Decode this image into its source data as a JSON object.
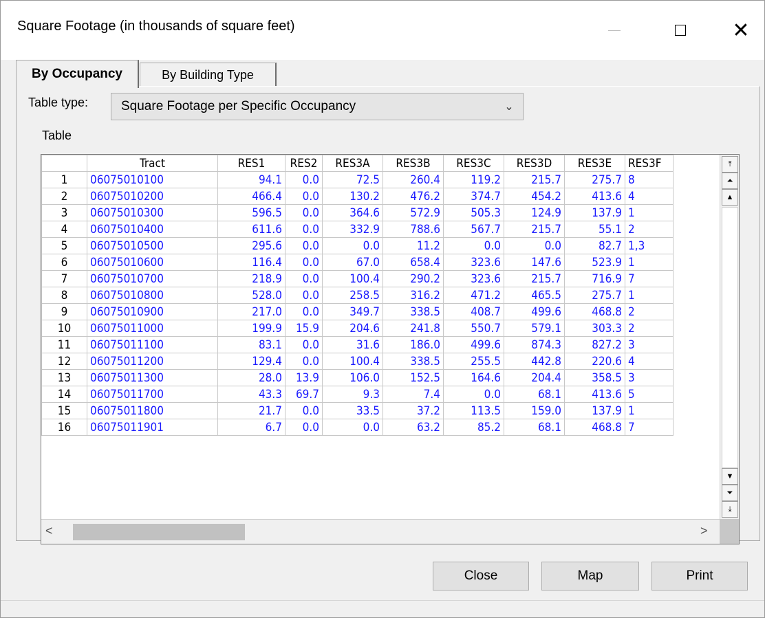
{
  "window": {
    "title": "Square Footage (in thousands of square feet)"
  },
  "tabs": [
    {
      "label": "By Occupancy",
      "active": true
    },
    {
      "label": "By Building Type",
      "active": false
    }
  ],
  "table_type": {
    "label": "Table type:",
    "selected": "Square Footage per Specific Occupancy"
  },
  "table_label": "Table",
  "grid": {
    "columns": [
      "",
      "Tract",
      "RES1",
      "RES2",
      "RES3A",
      "RES3B",
      "RES3C",
      "RES3D",
      "RES3E",
      "RES3F"
    ],
    "rows": [
      [
        "1",
        "06075010100",
        "94.1",
        "0.0",
        "72.5",
        "260.4",
        "119.2",
        "215.7",
        "275.7",
        "8"
      ],
      [
        "2",
        "06075010200",
        "466.4",
        "0.0",
        "130.2",
        "476.2",
        "374.7",
        "454.2",
        "413.6",
        "4"
      ],
      [
        "3",
        "06075010300",
        "596.5",
        "0.0",
        "364.6",
        "572.9",
        "505.3",
        "124.9",
        "137.9",
        "1"
      ],
      [
        "4",
        "06075010400",
        "611.6",
        "0.0",
        "332.9",
        "788.6",
        "567.7",
        "215.7",
        "55.1",
        "2"
      ],
      [
        "5",
        "06075010500",
        "295.6",
        "0.0",
        "0.0",
        "11.2",
        "0.0",
        "0.0",
        "82.7",
        "1,3"
      ],
      [
        "6",
        "06075010600",
        "116.4",
        "0.0",
        "67.0",
        "658.4",
        "323.6",
        "147.6",
        "523.9",
        "1"
      ],
      [
        "7",
        "06075010700",
        "218.9",
        "0.0",
        "100.4",
        "290.2",
        "323.6",
        "215.7",
        "716.9",
        "7"
      ],
      [
        "8",
        "06075010800",
        "528.0",
        "0.0",
        "258.5",
        "316.2",
        "471.2",
        "465.5",
        "275.7",
        "1"
      ],
      [
        "9",
        "06075010900",
        "217.0",
        "0.0",
        "349.7",
        "338.5",
        "408.7",
        "499.6",
        "468.8",
        "2"
      ],
      [
        "10",
        "06075011000",
        "199.9",
        "15.9",
        "204.6",
        "241.8",
        "550.7",
        "579.1",
        "303.3",
        "2"
      ],
      [
        "11",
        "06075011100",
        "83.1",
        "0.0",
        "31.6",
        "186.0",
        "499.6",
        "874.3",
        "827.2",
        "3"
      ],
      [
        "12",
        "06075011200",
        "129.4",
        "0.0",
        "100.4",
        "338.5",
        "255.5",
        "442.8",
        "220.6",
        "4"
      ],
      [
        "13",
        "06075011300",
        "28.0",
        "13.9",
        "106.0",
        "152.5",
        "164.6",
        "204.4",
        "358.5",
        "3"
      ],
      [
        "14",
        "06075011700",
        "43.3",
        "69.7",
        "9.3",
        "7.4",
        "0.0",
        "68.1",
        "413.6",
        "5"
      ],
      [
        "15",
        "06075011800",
        "21.7",
        "0.0",
        "33.5",
        "37.2",
        "113.5",
        "159.0",
        "137.9",
        "1"
      ],
      [
        "16",
        "06075011901",
        "6.7",
        "0.0",
        "0.0",
        "63.2",
        "85.2",
        "68.1",
        "468.8",
        "7"
      ]
    ]
  },
  "buttons": {
    "close": "Close",
    "map": "Map",
    "print": "Print"
  }
}
